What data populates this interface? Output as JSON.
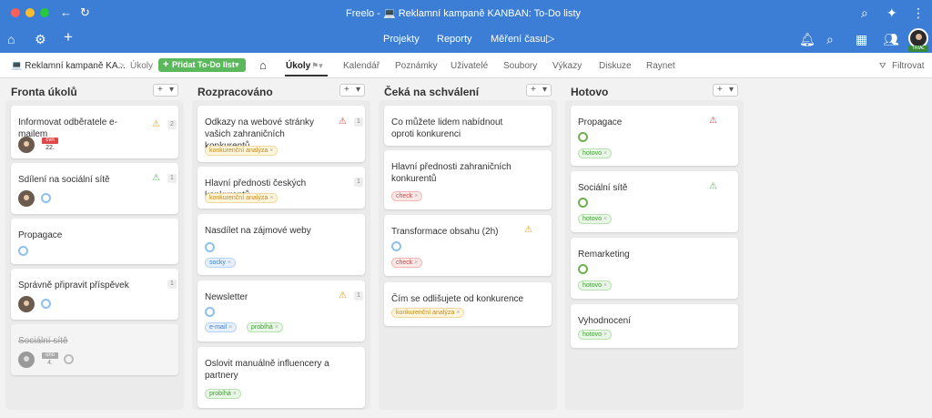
{
  "window": {
    "title": "Freelo - 💻 Reklamní kampaně KANBAN: To-Do listy"
  },
  "appbar": {
    "nav": [
      "Projekty",
      "Reporty",
      "Měření času"
    ],
    "trial_badge": "TRIAL"
  },
  "subbar": {
    "project": "💻 Reklamní kampaně KA...",
    "separator": ">",
    "breadcrumb_current": "Úkoly",
    "add_button": "Přidat To-Do list",
    "tabs": [
      "Úkoly",
      "Kalendář",
      "Poznámky",
      "Uživatelé",
      "Soubory",
      "Výkazy",
      "Diskuze",
      "Raynet"
    ],
    "filter": "Filtrovat"
  },
  "colors": {
    "brand": "#3c7ed6",
    "add_button": "#5cb85c",
    "warning_red": "#e04848",
    "warning_orange": "#f0a020",
    "warning_green": "#5cb85c"
  },
  "columns": [
    {
      "title": "Fronta úkolů",
      "cards": [
        {
          "title": "Informovat odběratele e-mailem",
          "count": "2",
          "warning": "orange",
          "date_day": "čvn",
          "date_num": "22."
        },
        {
          "title": "Sdílení na sociální sítě",
          "count": "1",
          "warning": "green"
        },
        {
          "title": "Propagace"
        },
        {
          "title": "Správně připravit příspěvek",
          "count": "1"
        },
        {
          "title": "Sociální sítě",
          "done": true,
          "date_day": "úno",
          "date_num": "4."
        }
      ]
    },
    {
      "title": "Rozpracováno",
      "cards": [
        {
          "title": "Odkazy na webové stránky vašich zahraničních konkurentů",
          "count": "1",
          "warning": "red",
          "tags": [
            "konkurenční analýza"
          ]
        },
        {
          "title": "Hlavní přednosti českých konkurentů",
          "count": "1",
          "tags": [
            "konkurenční analýza"
          ]
        },
        {
          "title": "Nasdílet na zájmové weby",
          "tags": [
            "socky"
          ]
        },
        {
          "title": "Newsletter",
          "count": "1",
          "warning": "orange",
          "tags": [
            "e-mail",
            "probíhá"
          ]
        },
        {
          "title": "Oslovit manuálně influencery a partnery",
          "tags": [
            "probíhá"
          ]
        }
      ]
    },
    {
      "title": "Čeká na schválení",
      "cards": [
        {
          "title": "Co můžete lidem nabídnout oproti konkurenci"
        },
        {
          "title": "Hlavní přednosti zahraničních konkurentů",
          "tags": [
            "check"
          ]
        },
        {
          "title": "Transformace obsahu (2h)",
          "warning": "orange",
          "tags": [
            "check"
          ]
        },
        {
          "title": "Čím se odlišujete od konkurence",
          "tags": [
            "konkurenční analýza"
          ]
        }
      ]
    },
    {
      "title": "Hotovo",
      "cards": [
        {
          "title": "Propagace",
          "warning": "red",
          "tags": [
            "hotovo"
          ]
        },
        {
          "title": "Sociální sítě",
          "warning": "green",
          "tags": [
            "hotovo"
          ]
        },
        {
          "title": "Remarketing",
          "tags": [
            "hotovo"
          ]
        },
        {
          "title": "Vyhodnocení",
          "tags": [
            "hotovo"
          ]
        }
      ]
    }
  ],
  "icons": {
    "warning": "⚠",
    "tag_remove": "×",
    "plus": "+",
    "dropdown": "▾"
  }
}
